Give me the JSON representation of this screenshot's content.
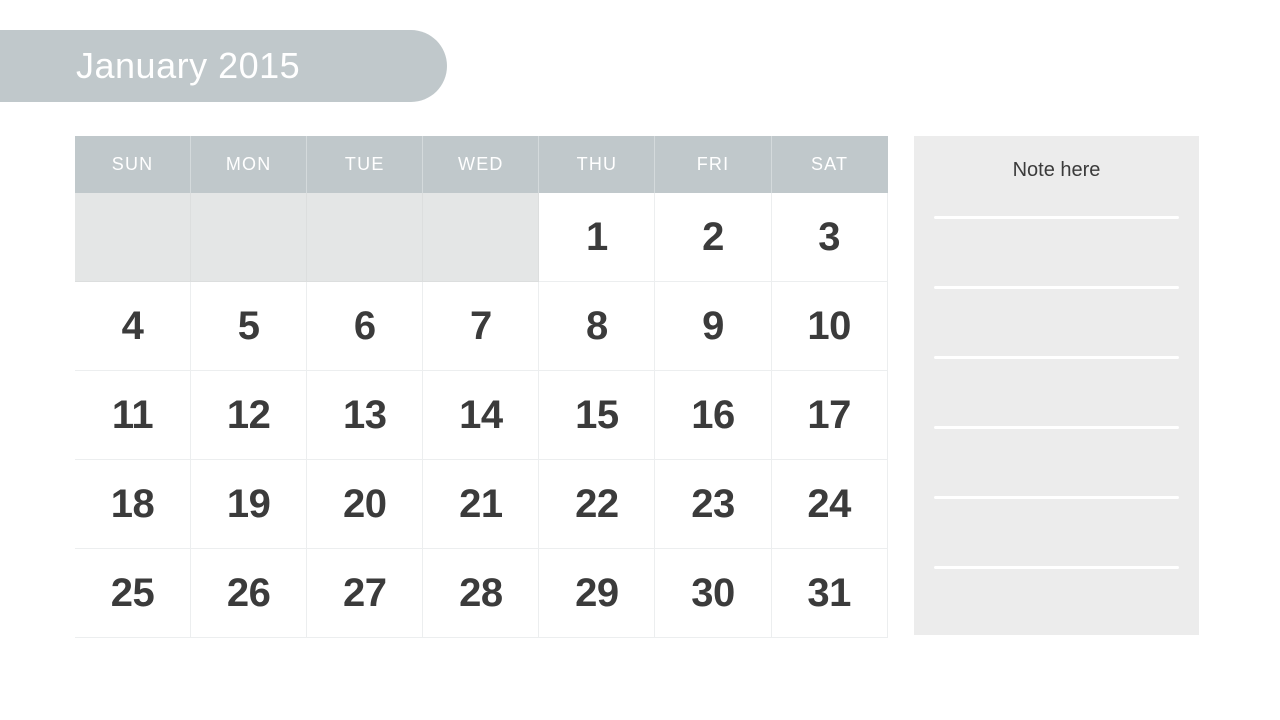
{
  "title": {
    "month_year": "January 2015"
  },
  "calendar": {
    "weekday_headers": [
      "SUN",
      "MON",
      "TUE",
      "WED",
      "THU",
      "FRI",
      "SAT"
    ],
    "weeks": [
      [
        "",
        "",
        "",
        "",
        "1",
        "2",
        "3"
      ],
      [
        "4",
        "5",
        "6",
        "7",
        "8",
        "9",
        "10"
      ],
      [
        "11",
        "12",
        "13",
        "14",
        "15",
        "16",
        "17"
      ],
      [
        "18",
        "19",
        "20",
        "21",
        "22",
        "23",
        "24"
      ],
      [
        "25",
        "26",
        "27",
        "28",
        "29",
        "30",
        "31"
      ]
    ]
  },
  "note_panel": {
    "title": "Note here",
    "line_count": 7
  },
  "colors": {
    "banner": "#c0c8cb",
    "header": "#c0c8cb",
    "empty_cell": "#e4e6e6",
    "day_cell": "#ffffff",
    "note_panel": "#ececec",
    "day_number": "#3b3b3b",
    "header_text": "#ffffff"
  }
}
